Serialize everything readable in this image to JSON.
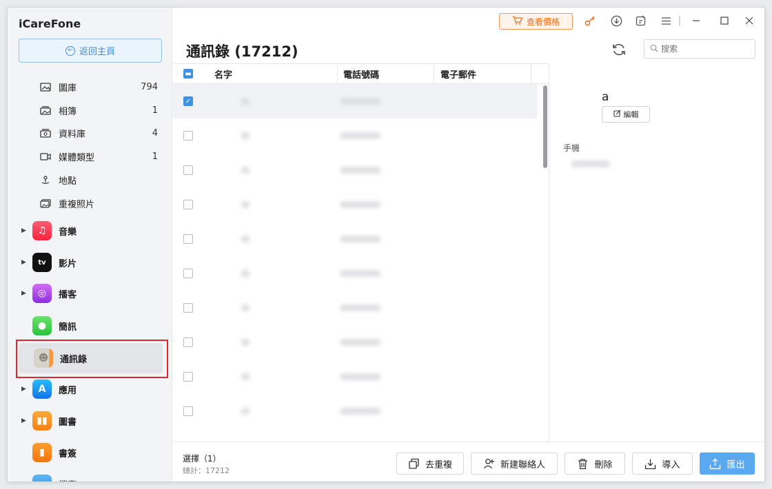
{
  "app": {
    "title": "iCareFone"
  },
  "sidebar": {
    "home_label": "返回主頁",
    "sub_items": [
      {
        "label": "圖庫",
        "count": "794"
      },
      {
        "label": "相簿",
        "count": "1"
      },
      {
        "label": "資料庫",
        "count": "4"
      },
      {
        "label": "媒體類型",
        "count": "1"
      },
      {
        "label": "地點",
        "count": ""
      },
      {
        "label": "重複照片",
        "count": ""
      }
    ],
    "categories": [
      {
        "label": "音樂"
      },
      {
        "label": "影片"
      },
      {
        "label": "播客"
      },
      {
        "label": "簡訊"
      },
      {
        "label": "通訊錄"
      },
      {
        "label": "應用"
      },
      {
        "label": "圖書"
      },
      {
        "label": "書簽"
      },
      {
        "label": "檔案"
      }
    ]
  },
  "toolbar": {
    "price_label": "查看價格"
  },
  "header": {
    "title": "通訊錄 (17212)",
    "search_placeholder": "搜索"
  },
  "table": {
    "columns": [
      "名字",
      "電話號碼",
      "電子郵件"
    ],
    "rows_checked": [
      true,
      false,
      false,
      false,
      false,
      false,
      false,
      false,
      false,
      false
    ]
  },
  "detail": {
    "name": "a",
    "edit_label": "編輯",
    "phone_label": "手機"
  },
  "footer": {
    "selected_label": "選擇（1）",
    "total_label": "總計：17212",
    "dedupe_label": "去重複",
    "new_contact_label": "新建聯絡人",
    "delete_label": "刪除",
    "import_label": "導入",
    "export_label": "匯出"
  },
  "colors": {
    "accent": "#3f93e2",
    "highlight_border": "#e0262d",
    "price_orange": "#ef6d16"
  }
}
